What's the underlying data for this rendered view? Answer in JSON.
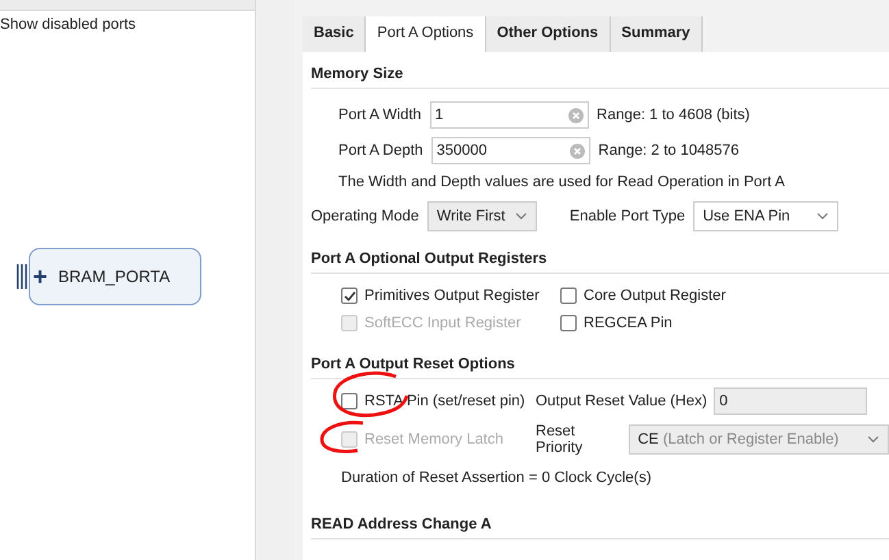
{
  "left_panel": {
    "show_disabled_ports": "Show disabled ports",
    "port_block": {
      "label": "BRAM_PORTA",
      "expand": "+"
    }
  },
  "tabs": [
    {
      "label": "Basic",
      "selected": false
    },
    {
      "label": "Port A Options",
      "selected": true
    },
    {
      "label": "Other Options",
      "selected": false
    },
    {
      "label": "Summary",
      "selected": false
    }
  ],
  "memory_size": {
    "title": "Memory Size",
    "fields": [
      {
        "label": "Port A Width",
        "value": "1",
        "range": "Range: 1 to 4608 (bits)"
      },
      {
        "label": "Port A Depth",
        "value": "350000",
        "range": "Range: 2 to 1048576"
      }
    ],
    "note": "The Width and Depth values are used for Read Operation in Port A",
    "operating_mode": {
      "label": "Operating Mode",
      "value": "Write First"
    },
    "enable_port_type": {
      "label": "Enable Port Type",
      "value": "Use ENA Pin"
    }
  },
  "output_registers": {
    "title": "Port A Optional Output Registers",
    "checkboxes": [
      {
        "label": "Primitives Output Register",
        "checked": true,
        "disabled": false
      },
      {
        "label": "Core Output Register",
        "checked": false,
        "disabled": false
      },
      {
        "label": "SoftECC Input Register",
        "checked": false,
        "disabled": true
      },
      {
        "label": "REGCEA Pin",
        "checked": false,
        "disabled": false
      }
    ]
  },
  "reset_options": {
    "title": "Port A Output Reset Options",
    "rsta_pin": {
      "label": "RSTA Pin (set/reset pin)",
      "checked": false,
      "disabled": false
    },
    "reset_memory_latch": {
      "label": "Reset Memory Latch",
      "checked": false,
      "disabled": true
    },
    "output_reset_value": {
      "label": "Output Reset Value (Hex)",
      "value": "0"
    },
    "reset_priority": {
      "label": "Reset Priority",
      "value": "CE",
      "hint": "(Latch or Register Enable)",
      "disabled": true
    },
    "duration": "Duration of Reset Assertion = 0 Clock Cycle(s)"
  },
  "read_address": {
    "title": "READ Address Change A"
  }
}
